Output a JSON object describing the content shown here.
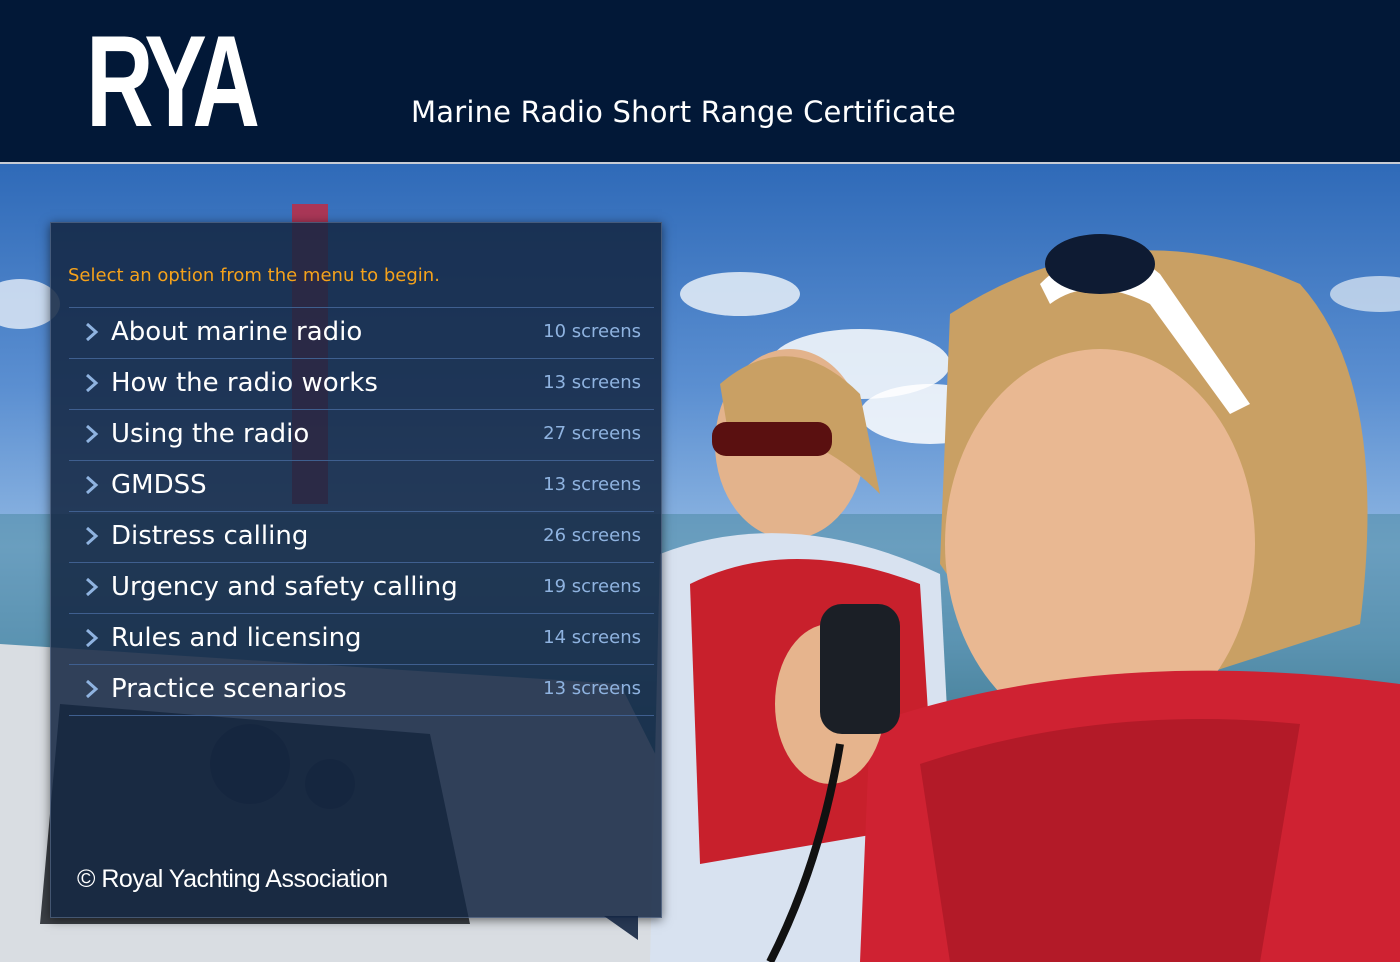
{
  "header": {
    "logo_text": "RYA",
    "title": "Marine Radio Short Range Certificate"
  },
  "menu": {
    "instruction": "Select an option from the menu to begin.",
    "items": [
      {
        "label": "About marine radio",
        "count": "10 screens"
      },
      {
        "label": "How the radio works",
        "count": "13 screens"
      },
      {
        "label": "Using the radio",
        "count": "27 screens"
      },
      {
        "label": "GMDSS",
        "count": "13 screens"
      },
      {
        "label": "Distress calling",
        "count": "26 screens"
      },
      {
        "label": "Urgency and safety calling",
        "count": "19 screens"
      },
      {
        "label": "Rules and licensing",
        "count": "14 screens"
      },
      {
        "label": "Practice scenarios",
        "count": "13 screens"
      }
    ],
    "copyright": "© Royal Yachting Association"
  },
  "colors": {
    "header_bg": "#021837",
    "panel_bg": "#142642",
    "accent_orange": "#f5a21b",
    "count_blue": "#8fb3e0",
    "divider": "#3f5f8f"
  },
  "icons": {
    "menu_item": "chevron-right-icon"
  }
}
